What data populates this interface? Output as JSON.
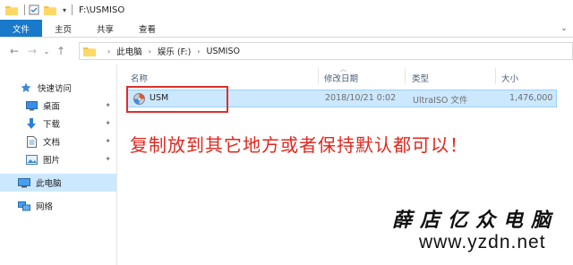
{
  "title": {
    "path": "F:\\USMISO"
  },
  "ribbon": {
    "tabs": [
      "文件",
      "主页",
      "共享",
      "查看"
    ]
  },
  "address": {
    "crumbs": [
      "此电脑",
      "娱乐 (F:)",
      "USMISO"
    ]
  },
  "nav": {
    "items": [
      {
        "label": "快速访问",
        "icon": "star-icon"
      },
      {
        "label": "桌面",
        "icon": "desktop-icon",
        "pinned": true
      },
      {
        "label": "下载",
        "icon": "download-icon",
        "pinned": true
      },
      {
        "label": "文档",
        "icon": "document-icon",
        "pinned": true
      },
      {
        "label": "图片",
        "icon": "picture-icon",
        "pinned": true
      },
      {
        "label": "此电脑",
        "icon": "computer-icon",
        "selected": true
      },
      {
        "label": "网络",
        "icon": "network-icon"
      }
    ]
  },
  "columns": {
    "name": "名称",
    "date": "修改日期",
    "type": "类型",
    "size": "大小"
  },
  "files": [
    {
      "name": "USM",
      "date": "2018/10/21 0:02",
      "type": "UltraISO 文件",
      "size": "1,476,000",
      "selected": true
    }
  ],
  "annotation": "复制放到其它地方或者保持默认都可以！",
  "watermark": {
    "name": "薛店亿众电脑",
    "url": "www.yzdn.net"
  },
  "colors": {
    "accent": "#1979ca",
    "selection": "#cce8ff",
    "annotation_red": "#e2261e"
  }
}
